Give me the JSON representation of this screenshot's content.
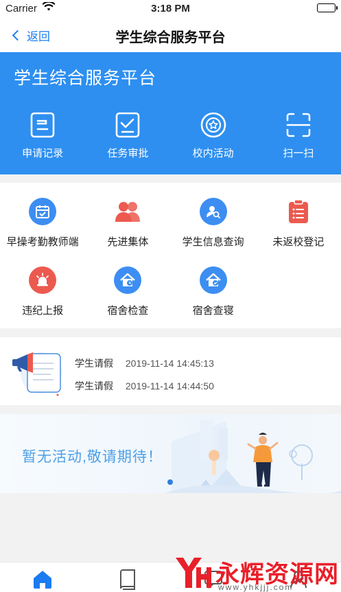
{
  "status_bar": {
    "carrier": "Carrier",
    "time": "3:18 PM"
  },
  "nav": {
    "back_label": "返回",
    "title": "学生综合服务平台"
  },
  "hero": {
    "title": "学生综合服务平台",
    "quick_actions": [
      {
        "label": "申请记录",
        "icon": "record-icon"
      },
      {
        "label": "任务审批",
        "icon": "approve-icon"
      },
      {
        "label": "校内活动",
        "icon": "activity-icon"
      },
      {
        "label": "扫一扫",
        "icon": "scan-icon"
      }
    ]
  },
  "services": [
    {
      "label": "早操考勤教师端",
      "icon": "calendar-check-icon",
      "color": "#3d8ef2"
    },
    {
      "label": "先进集体",
      "icon": "group-icon",
      "color": "#ec5a4f"
    },
    {
      "label": "学生信息查询",
      "icon": "user-search-icon",
      "color": "#3d8ef2"
    },
    {
      "label": "未返校登记",
      "icon": "clipboard-icon",
      "color": "#ec5a4f"
    },
    {
      "label": "违纪上报",
      "icon": "alarm-icon",
      "color": "#ec5a4f"
    },
    {
      "label": "宿舍检查",
      "icon": "dorm-check-icon",
      "color": "#3d8ef2"
    },
    {
      "label": "宿舍查寝",
      "icon": "dorm-inspect-icon",
      "color": "#3d8ef2"
    }
  ],
  "notices": [
    {
      "type": "学生请假",
      "datetime": "2019-11-14 14:45:13"
    },
    {
      "type": "学生请假",
      "datetime": "2019-11-14 14:44:50"
    }
  ],
  "activity": {
    "empty_message": "暂无活动,敬请期待！"
  },
  "tab_bar": {
    "tabs": [
      "home-icon",
      "book-icon",
      "message-icon",
      "profile-icon"
    ],
    "active_color": "#1a7cf0"
  },
  "watermark": {
    "text": "永辉资源网",
    "url": "www.yhkjjj.com"
  },
  "colors": {
    "primary": "#2e8ff0",
    "accent_red": "#ec5a4f"
  }
}
